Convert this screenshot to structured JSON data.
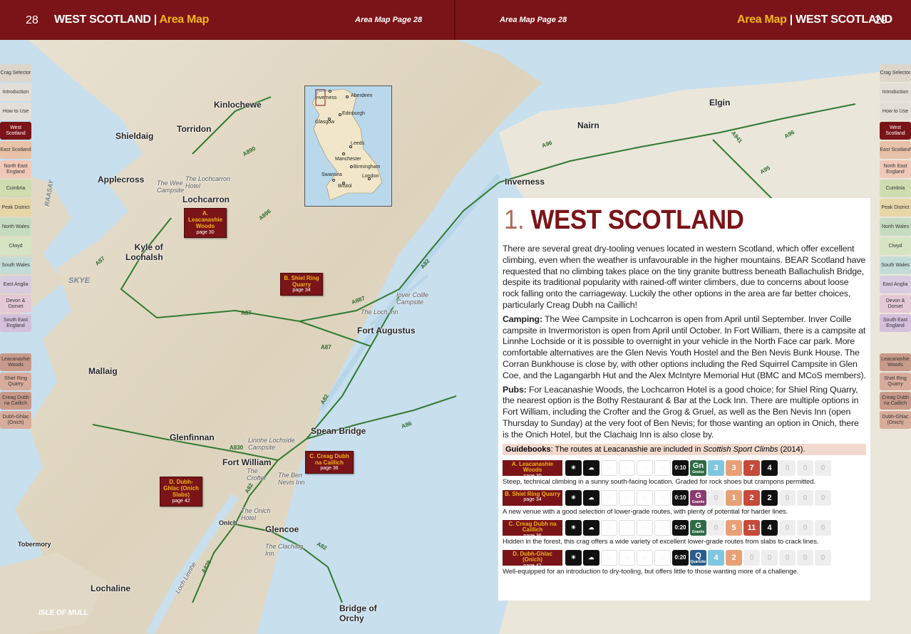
{
  "header": {
    "left_page_num": "28",
    "left_title_main": "WEST SCOTLAND | ",
    "left_title_accent": "Area Map",
    "left_mid": "Area Map Page 28",
    "right_mid": "Area Map Page 28",
    "right_title_accent": "Area Map",
    "right_title_main": " | WEST SCOTLAND",
    "right_page_num": "29"
  },
  "side_tabs": {
    "chapters": [
      "Crag Selector",
      "Introduction",
      "How to Use",
      "West Scotland",
      "East Scotland",
      "North East England",
      "Cumbria",
      "Peak District",
      "North Wales",
      "Clwyd",
      "South Wales",
      "East Anglia",
      "Devon & Dorset",
      "South East England"
    ],
    "active": "West Scotland",
    "crags": [
      "Leacanashie Woods",
      "Shiel Ring Quarry",
      "Creag Dubh na Caillich",
      "Dubh-Ghlac (Onich)"
    ]
  },
  "map": {
    "places": {
      "kinlochewe": "Kinlochewe",
      "torridon": "Torridon",
      "shieldaig": "Shieldaig",
      "applecross": "Applecross",
      "lochcarron": "Lochcarron",
      "kyle": "Kyle of\nLochalsh",
      "mallaig": "Mallaig",
      "glenfinnan": "Glenfinnan",
      "fort_william": "Fort William",
      "spean_bridge": "Spean Bridge",
      "fort_augustus": "Fort Augustus",
      "inverness": "Inverness",
      "nairn": "Nairn",
      "elgin": "Elgin",
      "glencoe": "Glencoe",
      "onich": "Onich",
      "tobermory": "Tobermory",
      "lochaline": "Lochaline",
      "bridge_of_orchy": "Bridge of\nOrchy",
      "skye": "SKYE",
      "raasay": "RAASAY",
      "isle_of_mull": "ISLE OF MULL",
      "wee_campsite": "The Wee\nCampsite",
      "lochcarron_hotel": "The Lochcarron\nHotel",
      "loch_inn": "The Loch Inn",
      "inver_coille": "Inver Coille\nCampsite",
      "linnhe": "Linnhe Lochside\nCampsite",
      "crofter": "The\nCrofter",
      "ben_nevis_inn": "The Ben\nNevis Inn",
      "onich_hotel": "The Onich\nHotel",
      "clachaig": "The Clachaig\nInn",
      "loch_linnhe": "Loch Linnhe"
    },
    "roads": [
      "A890",
      "A896",
      "A87",
      "A87",
      "A887",
      "A87",
      "A82",
      "A82",
      "A830",
      "A82",
      "A86",
      "A828",
      "A82",
      "A96",
      "A96",
      "A95",
      "A941"
    ],
    "markers": [
      {
        "letter": "A.",
        "name": "Leacanashie Woods",
        "page": "page 30"
      },
      {
        "letter": "B.",
        "name": "Shiel Ring Quarry",
        "page": "page 34"
      },
      {
        "letter": "C.",
        "name": "Creag Dubh na Caillich",
        "page": "page 36"
      },
      {
        "letter": "D.",
        "name": "Dubh-Ghlac (Onich Slabs)",
        "page": "page 42"
      }
    ],
    "inset": {
      "cities": [
        "Inverness",
        "Aberdeen",
        "Edinburgh",
        "Glasgow",
        "Leeds",
        "Manchester",
        "Birmingham",
        "Swansea",
        "London",
        "Bristol"
      ]
    }
  },
  "panel": {
    "title_num": "1.",
    "title_text": "WEST SCOTLAND",
    "intro": "There are several great dry-tooling venues located in western Scotland, which offer excellent climbing, even when the weather is unfavourable in the higher mountains. BEAR Scotland have requested that no climbing takes place on the tiny granite buttress beneath Ballachulish Bridge, despite its traditional popularity with rained-off winter climbers, due to concerns about loose rock falling onto the carriageway. Luckily the other options in the area are far better choices, particularly Creag Dubh na Caillich!",
    "camping_label": "Camping:",
    "camping": " The Wee Campsite in Lochcarron is open from April until September. Inver Coille campsite in Invermoriston is open from April until October. In Fort William, there is a campsite at Linnhe Lochside or it is possible to overnight in your vehicle in the North Face car park. More comfortable alternatives are the Glen Nevis Youth Hostel and the Ben Nevis Bunk House. The Corran Bunkhouse is close by, with other options including the Red Squirrel Campsite in Glen Coe, and the Lagangarbh Hut and the Alex McIntyre Memorial Hut (BMC and MCoS members).",
    "pubs_label": "Pubs:",
    "pubs": " For Leacanashie Woods, the Lochcarron Hotel is a good choice; for Shiel Ring Quarry, the nearest option is the Bothy Restaurant & Bar at the Lock Inn. There are multiple options in Fort William, including the Crofter and the Grog & Gruel, as well as the Ben Nevis Inn (open Thursday to Sunday) at the very foot of Ben Nevis; for those wanting an option in Onich, there is the Onich Hotel, but the Clachaig Inn is also close by.",
    "guide_label": "Guidebooks",
    "guide_text": ": The routes at Leacanashie are included in ",
    "guide_book": "Scottish Sport Climbs",
    "guide_year": " (2014).",
    "crags": [
      {
        "tag": "A. Leacanashie Woods",
        "page": "page 30",
        "time": "0:10",
        "grade_letter": "Gn",
        "grade_word": "Gneiss",
        "grade_color": "#2e6b45",
        "counts": [
          "3",
          "3",
          "7",
          "4",
          "0",
          "0",
          "0"
        ],
        "desc": "Steep, technical climbing in a sunny south-facing location. Graded for rock shoes but crampons permitted."
      },
      {
        "tag": "B. Shiel Ring Quarry",
        "page": "page 34",
        "time": "0:10",
        "grade_letter": "G",
        "grade_word": "Granite",
        "grade_color": "#8a3a6e",
        "counts": [
          "0",
          "1",
          "2",
          "2",
          "0",
          "0",
          "0"
        ],
        "desc": "A new venue with a good selection of lower-grade routes, with plenty of potential for harder lines."
      },
      {
        "tag": "C. Creag Dubh na Caillich",
        "page": "page 36",
        "time": "0:20",
        "grade_letter": "G",
        "grade_word": "Granite",
        "grade_color": "#2e6b45",
        "counts": [
          "0",
          "5",
          "11",
          "4",
          "0",
          "0",
          "0"
        ],
        "desc": "Hidden in the forest, this crag offers a wide variety of excellent lower-grade routes from slabs to crack lines."
      },
      {
        "tag": "D. Dubh-Ghlac (Onich)",
        "page": "page 42",
        "time": "0:20",
        "grade_letter": "Q",
        "grade_word": "Quartzite",
        "grade_color": "#2a5a8a",
        "counts": [
          "4",
          "2",
          "0",
          "0",
          "0",
          "0",
          "0"
        ],
        "desc": "Well-equipped for an introduction to dry-tooling, but offers little to those wanting more of a challenge."
      }
    ]
  }
}
